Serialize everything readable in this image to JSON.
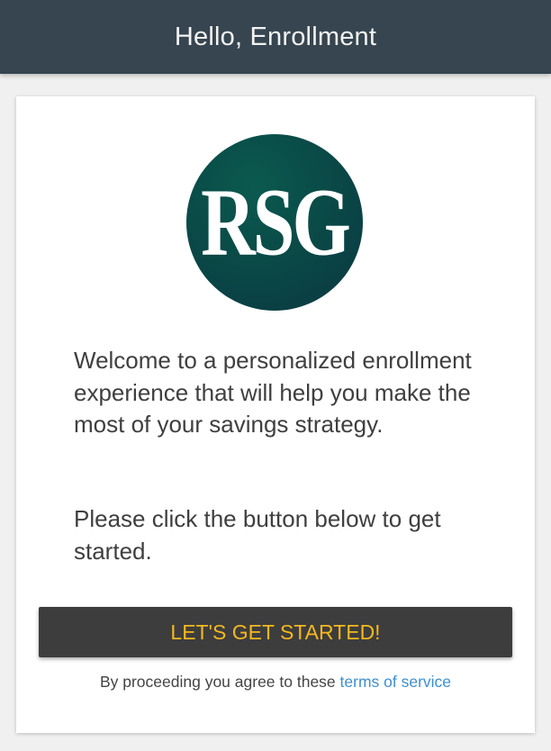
{
  "header": {
    "title": "Hello, Enrollment"
  },
  "logo": {
    "text": "RSG",
    "colors": [
      "#0b5a4f",
      "#0a3742"
    ]
  },
  "content": {
    "welcome_text": "Welcome to a personalized enrollment experience that will help you make the most of your savings strategy.",
    "instruction_text": "Please click the button below to get started."
  },
  "start_button": {
    "label": "LET'S GET STARTED!",
    "background": "#3d3d3d",
    "text_color": "#f5b820"
  },
  "terms": {
    "prefix": "By proceeding you agree to these ",
    "link_label": "terms of service",
    "link_color": "#3d8fd1"
  },
  "colors": {
    "header_bg": "#36454f",
    "page_bg": "#f0f0f0",
    "body_text": "#3f3f3f"
  }
}
